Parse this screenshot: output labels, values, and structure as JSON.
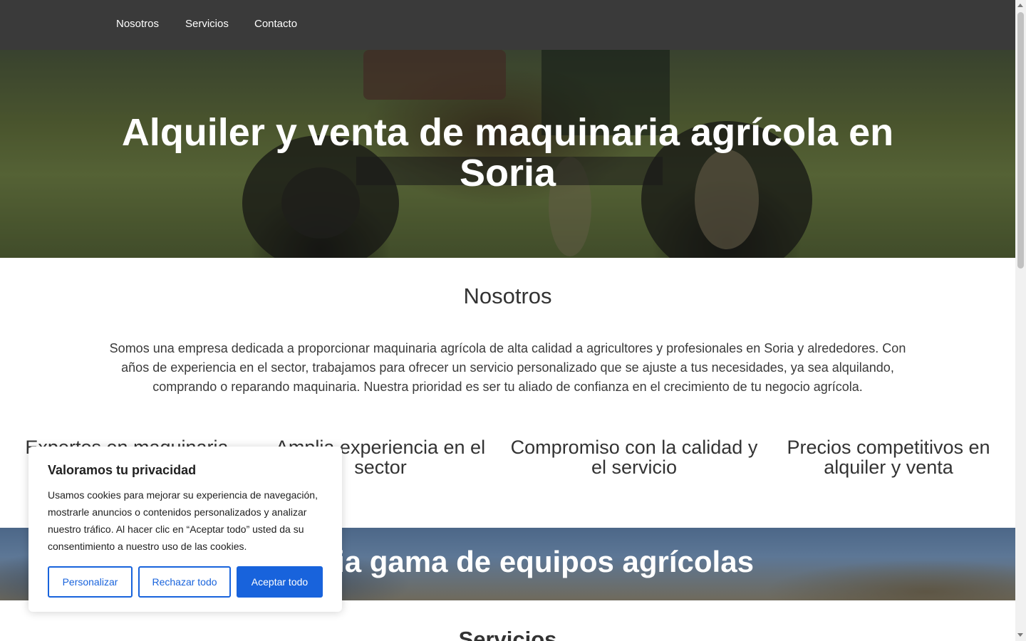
{
  "nav": {
    "items": [
      {
        "label": "Nosotros"
      },
      {
        "label": "Servicios"
      },
      {
        "label": "Contacto"
      }
    ]
  },
  "hero": {
    "title": "Alquiler y venta de maquinaria agrícola en Soria"
  },
  "about": {
    "heading": "Nosotros",
    "text": "Somos una empresa dedicada a proporcionar maquinaria agrícola de alta calidad a agricultores y profesionales en Soria y alrededores. Con años de experiencia en el sector, trabajamos para ofrecer un servicio personalizado que se ajuste a tus necesidades, ya sea alquilando, comprando o reparando maquinaria. Nuestra prioridad es ser tu aliado de confianza en el crecimiento de tu negocio agrícola."
  },
  "features": [
    {
      "title": "Expertos en maquinaria"
    },
    {
      "title": "Amplia experiencia en el sector"
    },
    {
      "title": "Compromiso con la calidad y el servicio"
    },
    {
      "title": "Precios competitivos en alquiler y venta"
    }
  ],
  "band": {
    "title": "Amplia gama de equipos agrícolas"
  },
  "services": {
    "heading": "Servicios"
  },
  "cookie_banner": {
    "title": "Valoramos tu privacidad",
    "text": "Usamos cookies para mejorar su experiencia de navegación, mostrarle anuncios o contenidos personalizados y analizar nuestro tráfico. Al hacer clic en “Aceptar todo” usted da su consentimiento a nuestro uso de las cookies.",
    "customize_label": "Personalizar",
    "reject_label": "Rechazar todo",
    "accept_label": "Aceptar todo",
    "accent_color": "#1863dc"
  }
}
